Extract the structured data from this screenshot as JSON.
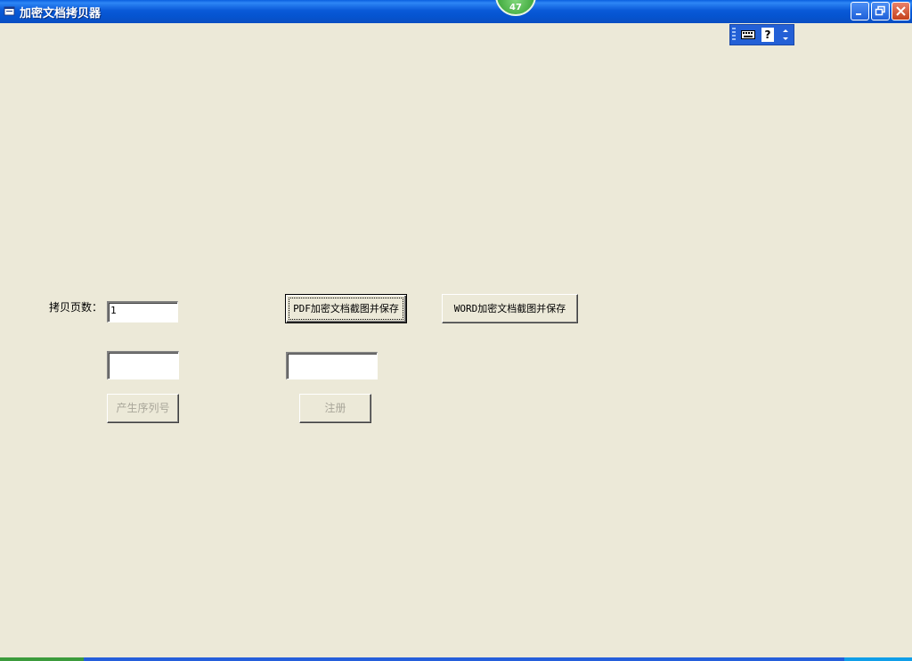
{
  "window": {
    "title": "加密文档拷贝器",
    "counter_badge": "47"
  },
  "form": {
    "copy_pages_label": "拷贝页数：",
    "copy_pages_value": "1",
    "serial_value": "",
    "register_code_value": "",
    "pdf_button_label": "PDF加密文档截图并保存",
    "word_button_label": "WORD加密文档截图并保存",
    "generate_serial_label": "产生序列号",
    "register_label": "注册"
  },
  "colors": {
    "background": "#ECE9D8",
    "titlebar": "#0a5ad8",
    "disabled_text": "#a9a69a"
  },
  "icons": [
    "app-icon",
    "minimize-icon",
    "restore-icon",
    "close-icon",
    "keyboard-icon",
    "help-icon",
    "arrows-icon"
  ]
}
